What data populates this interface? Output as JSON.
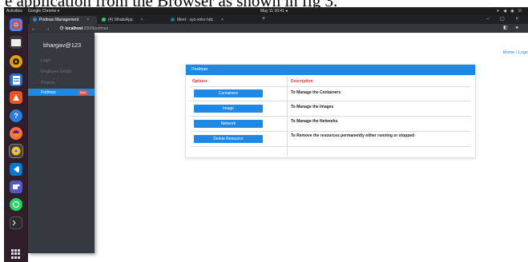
{
  "caption": "e application from the Browser as shown in fig 3.",
  "os_bar": {
    "activities": "Activities",
    "app_menu": "Google Chrome ▾",
    "clock": "May 11  20:41  ●",
    "tray": "▾ ◀ ◉ ⏻"
  },
  "dock": {
    "icons": [
      "chrome-icon",
      "files-icon",
      "rhythmbox-icon",
      "libreoffice-writer-icon",
      "software-center-icon",
      "help-icon",
      "firefox-icon",
      "chromium-icon",
      "vscode-icon",
      "teams-icon",
      "whatsapp-icon",
      "terminal-icon"
    ]
  },
  "browser": {
    "tabs": [
      {
        "label": "Podman Management",
        "color": "#1e88e5"
      },
      {
        "label": "(4) WhatsApp",
        "color": "#25d366"
      },
      {
        "label": "Meet - syo-xnkv-hdz",
        "color": "#00897b"
      }
    ],
    "url_host": "localhost",
    "url_path": ":3000/podman"
  },
  "sidebar": {
    "username": "bhargav@123",
    "items": [
      {
        "label": "Login"
      },
      {
        "label": "Employee Details"
      },
      {
        "label": "Projects"
      },
      {
        "label": "Podman",
        "badge": "New"
      }
    ]
  },
  "breadcrumb": "Home / Logo",
  "card": {
    "title": "Podman",
    "columns": [
      "Options",
      "Description"
    ],
    "rows": [
      {
        "button": "Containers",
        "description": "To Manage the Containers"
      },
      {
        "button": "Image",
        "description": "To Manage the Images"
      },
      {
        "button": "Network",
        "description": "To Manage the Networks"
      },
      {
        "button": "Delete Resource",
        "description": "To Remove the resources permanently either running or stopped"
      }
    ]
  },
  "colors": {
    "accent": "#1e88e5",
    "sidebar_bg": "#343a40",
    "header_text": "#e53935",
    "badge": "#ef5350"
  }
}
